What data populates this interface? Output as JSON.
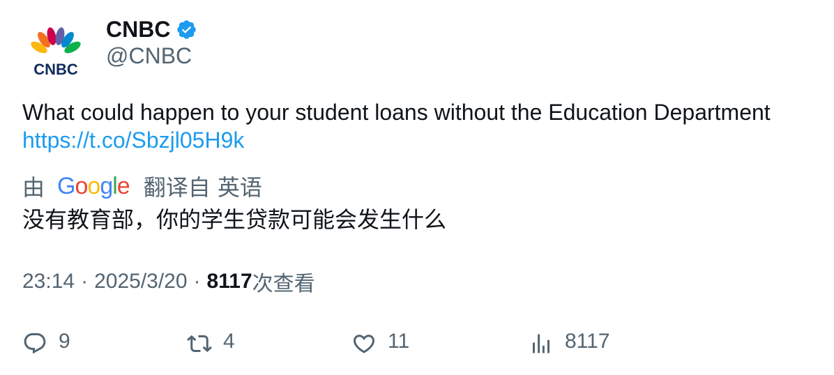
{
  "author": {
    "display_name": "CNBC",
    "handle": "@CNBC",
    "verified": true,
    "avatar_icon": "cnbc-peacock-logo",
    "avatar_wordmark": "CNBC"
  },
  "tweet": {
    "text": "What could happen to your student loans without the Education Department",
    "link": "https://t.co/Sbzjl05H9k"
  },
  "translation": {
    "prefix": "由",
    "provider_letters": [
      "G",
      "o",
      "o",
      "g",
      "l",
      "e"
    ],
    "suffix": "翻译自 英语",
    "translated_text": "没有教育部，你的学生贷款可能会发生什么"
  },
  "meta": {
    "time": "23:14",
    "separator": "·",
    "date": "2025/3/20",
    "views_count": "8117",
    "views_label": "次查看"
  },
  "actions": {
    "reply_count": "9",
    "retweet_count": "4",
    "like_count": "11",
    "views_count": "8117"
  },
  "colors": {
    "text_primary": "#0f1419",
    "text_secondary": "#536471",
    "link": "#1d9bf0",
    "verified_badge": "#1d9bf0"
  }
}
